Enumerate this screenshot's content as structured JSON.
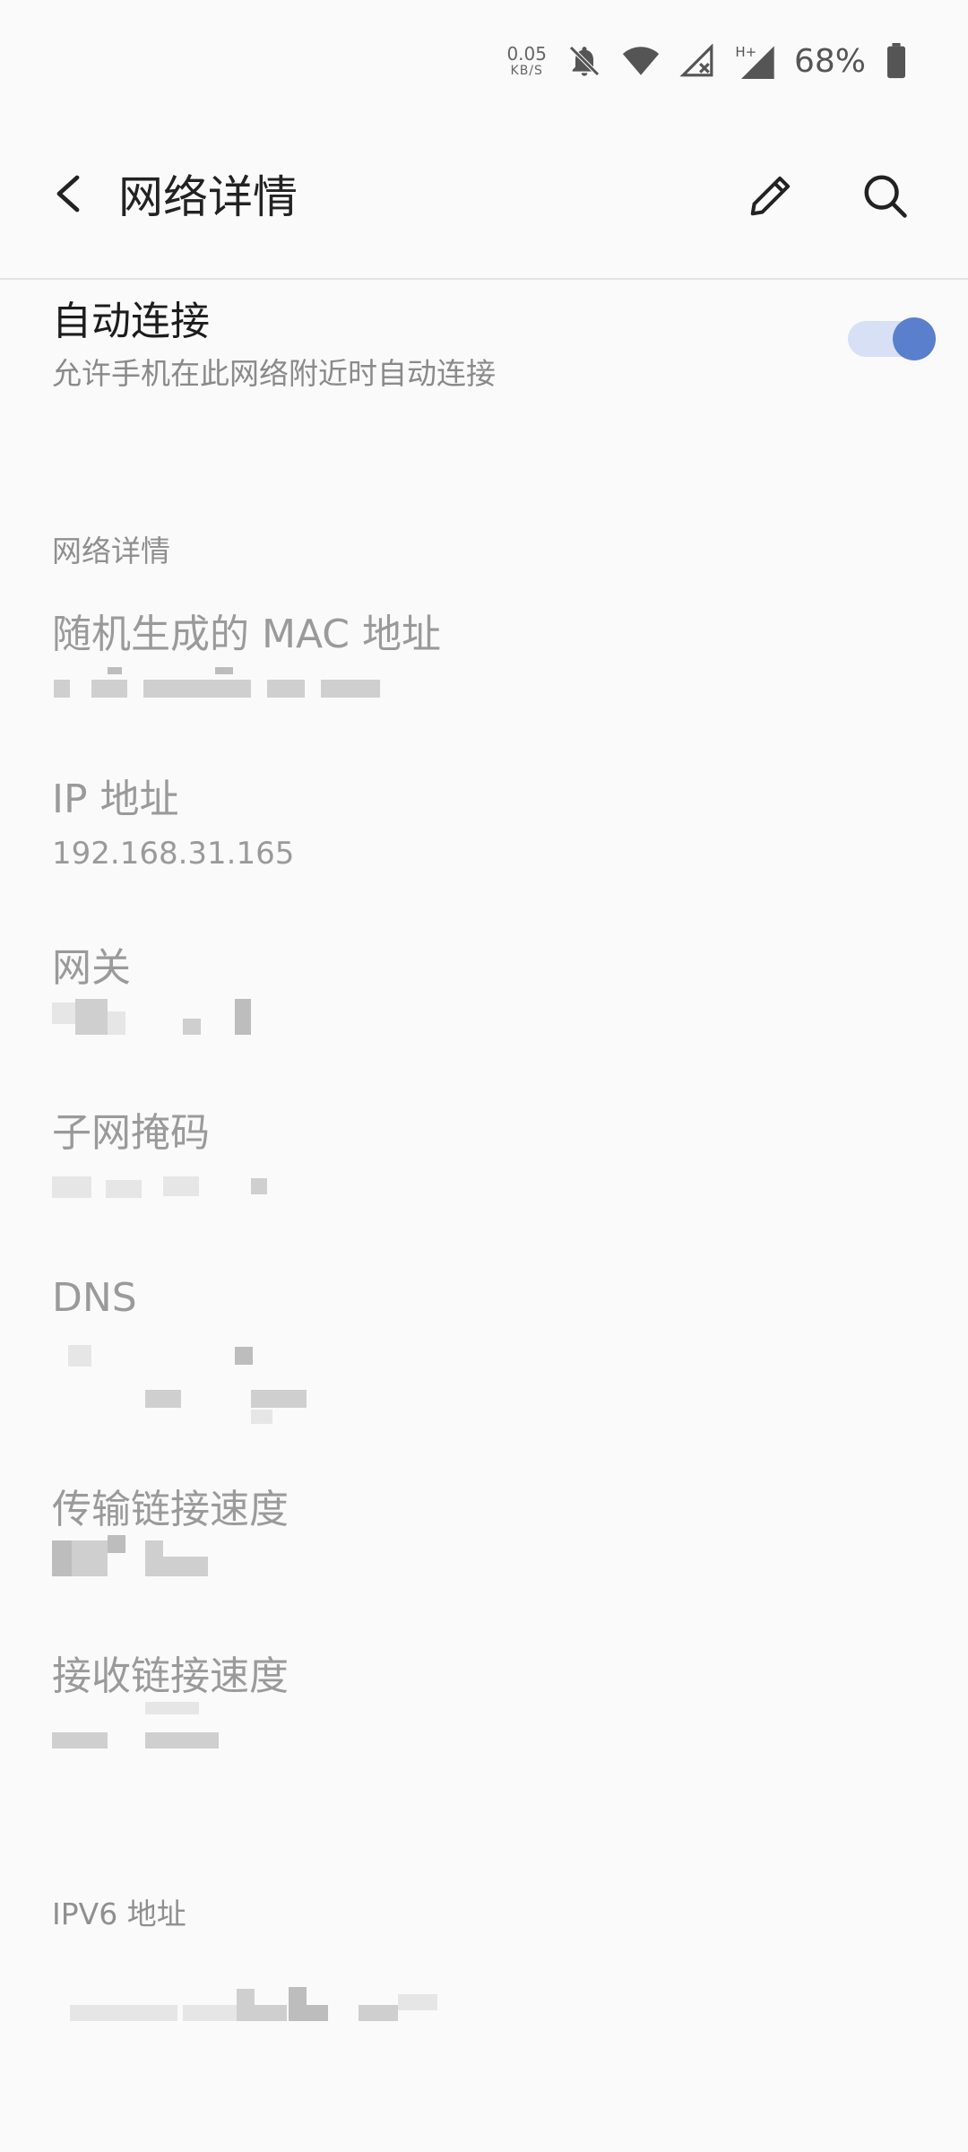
{
  "status_bar": {
    "net_speed_value": "0.05",
    "net_speed_unit": "KB/S",
    "battery_percent": "68%",
    "icons": [
      "bell-off-icon",
      "wifi-icon",
      "cellular-no-signal-icon",
      "cellular-h-plus-icon",
      "battery-icon"
    ]
  },
  "app_bar": {
    "title": "网络详情",
    "back_icon": "back-arrow-icon",
    "edit_icon": "pencil-icon",
    "search_icon": "search-icon"
  },
  "auto_connect": {
    "title": "自动连接",
    "subtitle": "允许手机在此网络附近时自动连接",
    "enabled": true
  },
  "network_details": {
    "section_title": "网络详情",
    "mac_label": "随机生成的 MAC 地址",
    "ip_label": "IP 地址",
    "ip_value": "192.168.31.165",
    "gateway_label": "网关",
    "subnet_label": "子网掩码",
    "dns_label": "DNS",
    "tx_label": "传输链接速度",
    "rx_label": "接收链接速度"
  },
  "ipv6": {
    "section_title": "IPV6 地址"
  },
  "colors": {
    "accent": "#5a7fcd",
    "toggle_track": "#d7e0f4",
    "background": "#fafafa",
    "secondary_text": "#8a8a8a"
  }
}
